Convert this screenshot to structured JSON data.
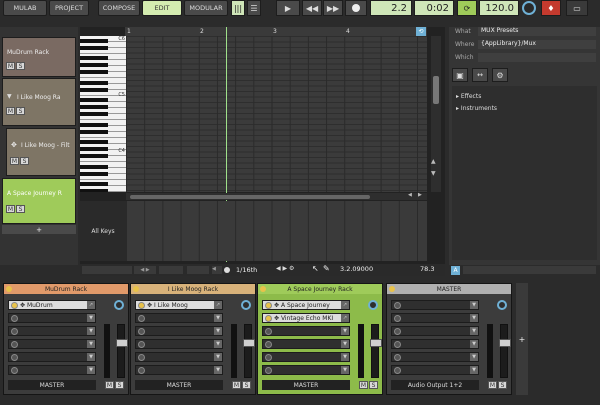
{
  "toolbar": {
    "mulab": "MULAB",
    "project": "PROJECT",
    "compose": "COMPOSE",
    "edit": "EDIT",
    "modular": "MODULAR",
    "position": "2.2",
    "time": "0:02",
    "tempo": "120.0"
  },
  "tracks": [
    {
      "name": "MuDrum Rack",
      "m": "M",
      "s": "S"
    },
    {
      "name": "I Like Moog Ra",
      "m": "M",
      "s": "S"
    },
    {
      "name": "I Like Moog - Filt",
      "m": "M",
      "s": "S"
    },
    {
      "name": "A Space Journey R",
      "m": "M",
      "s": "S"
    }
  ],
  "add_track": "+",
  "editor": {
    "ruler": [
      "1",
      "2",
      "3",
      "4"
    ],
    "octaves": [
      "C6",
      "C5",
      "C4"
    ],
    "all_keys": "All Keys",
    "grid": "1/16th",
    "cursor_pos": "3.2.09000",
    "value": "78.3"
  },
  "browser": {
    "what_label": "What",
    "what_value": "MUX Presets",
    "where_label": "Where",
    "where_value": "{AppLibrary}/Mux",
    "which_label": "Which",
    "which_value": "",
    "tree": [
      "Effects",
      "Instruments"
    ],
    "a_label": "A"
  },
  "mixer": [
    {
      "name": "MuDrum Rack",
      "color": "#e19a6a",
      "slots": [
        "MuDrum"
      ],
      "out": "MASTER"
    },
    {
      "name": "I Like Moog Rack",
      "color": "#d8b27a",
      "slots": [
        "I Like Moog"
      ],
      "out": "MASTER"
    },
    {
      "name": "A Space Journey Rack",
      "color": "#9fcb5a",
      "slots": [
        "A Space Journey",
        "Vintage Echo MKI"
      ],
      "out": "MASTER"
    },
    {
      "name": "MASTER",
      "color": "#b0b0b0",
      "slots": [],
      "out": "Audio Output 1+2"
    }
  ],
  "mixer_ms": {
    "m": "M",
    "s": "S"
  },
  "mixer_add": "+"
}
